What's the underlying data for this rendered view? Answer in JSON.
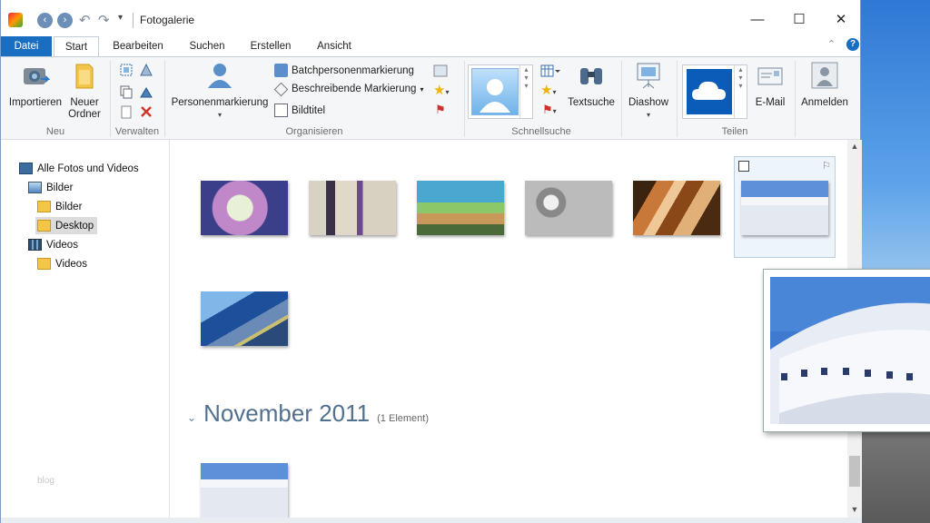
{
  "window": {
    "title": "Fotogalerie",
    "controls": {
      "minimize": "—",
      "maximize": "☐",
      "close": "✕"
    }
  },
  "ribbon_tabs": [
    {
      "label": "Datei"
    },
    {
      "label": "Start"
    },
    {
      "label": "Bearbeiten"
    },
    {
      "label": "Suchen"
    },
    {
      "label": "Erstellen"
    },
    {
      "label": "Ansicht"
    }
  ],
  "ribbon": {
    "neu": {
      "label": "Neu",
      "importieren": "Importieren",
      "neuer_ordner_1": "Neuer",
      "neuer_ordner_2": "Ordner"
    },
    "verwalten": {
      "label": "Verwalten"
    },
    "organisieren": {
      "label": "Organisieren",
      "personenmarkierung": "Personenmarkierung",
      "batch": "Batchpersonenmarkierung",
      "beschreibende": "Beschreibende Markierung",
      "bildtitel": "Bildtitel"
    },
    "schnellsuche": {
      "label": "Schnellsuche",
      "textsuche": "Textsuche"
    },
    "diashow": "Diashow",
    "teilen": {
      "label": "Teilen",
      "email": "E-Mail"
    },
    "anmelden": "Anmelden"
  },
  "nav": {
    "items": [
      {
        "label": "Alle Fotos und Videos"
      },
      {
        "label": "Bilder"
      },
      {
        "label": "Bilder"
      },
      {
        "label": "Desktop"
      },
      {
        "label": "Videos"
      },
      {
        "label": "Videos"
      }
    ],
    "selected": "Desktop",
    "watermark": "blog"
  },
  "content": {
    "group": {
      "month": "November 2011",
      "count": "(1 Element)"
    }
  },
  "colors": {
    "accent": "#1a6ec2",
    "month_heading": "#52718f"
  }
}
